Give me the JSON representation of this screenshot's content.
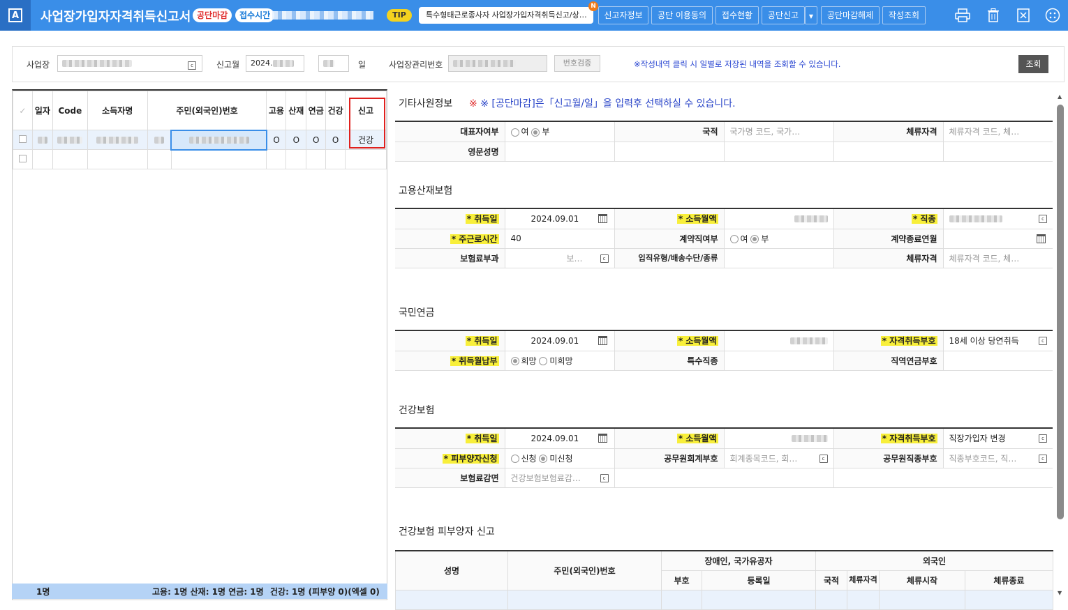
{
  "header": {
    "logo": "A",
    "title": "사업장가입자자격취득신고서",
    "badge_closed": "공단마감",
    "badge_recv": "접수시간",
    "tip": "TIP",
    "tip_text": "특수형태근로종사자 사업장가입자격취득신고/상…",
    "tip_badge": "N",
    "buttons": [
      "신고자정보",
      "공단 이용동의",
      "접수현황",
      "공단신고",
      "공단마감해제",
      "작성조회"
    ]
  },
  "search": {
    "biz_label": "사업장",
    "month_label": "신고월",
    "month_value": "2024.",
    "day_label": "일",
    "mgmt_label": "사업장관리번호",
    "verify": "번호검증",
    "notice": "※작성내역 클릭 시 일별로 저장된 내역을 조회할 수 있습니다.",
    "query": "조회"
  },
  "left": {
    "headers": [
      "일자",
      "Code",
      "소득자명",
      "주민(외국인)번호",
      "고용",
      "산재",
      "연금",
      "건강",
      "신고"
    ],
    "row": {
      "emp": "O",
      "ind": "O",
      "pen": "O",
      "hlth": "O",
      "report": "건강"
    },
    "footer": {
      "count": "1명",
      "summary": "고용: 1명 산재: 1명 연금: 1명",
      "health": "건강: 1명 (피부양 0)(엑셀 0)"
    }
  },
  "right": {
    "etc": {
      "title": "기타사원정보",
      "notice": "※ [공단마감]은「신고월/일」을 입력후 선택하실 수 있습니다.",
      "rep": "대표자여부",
      "yes": "여",
      "no": "부",
      "nation": "국적",
      "nation_ph": "국가명 코드, 국가…",
      "stay": "체류자격",
      "stay_ph": "체류자격 코드, 체…",
      "eng": "영문성명"
    },
    "emp": {
      "title": "고용산재보험",
      "acq": "* 취득일",
      "acq_val": "2024.09.01",
      "income": "* 소득월액",
      "job": "* 직종",
      "hours": "* 주근로시간",
      "hours_val": "40",
      "contract": "계약직여부",
      "yes": "여",
      "no": "부",
      "end": "계약종료연월",
      "premium": "보험료부과",
      "premium_ph": "보…",
      "entry": "입직유형/배송수단/종류",
      "stay": "체류자격",
      "stay_ph": "체류자격 코드, 체…"
    },
    "pen": {
      "title": "국민연금",
      "acq": "* 취득일",
      "acq_val": "2024.09.01",
      "income": "* 소득월액",
      "code": "* 자격취득부호",
      "code_val": "18세 이상 당연취득",
      "pay": "* 취득월납부",
      "want": "희망",
      "nowant": "미희망",
      "special": "특수직종",
      "occ": "직역연금부호"
    },
    "hlth": {
      "title": "건강보험",
      "acq": "* 취득일",
      "acq_val": "2024.09.01",
      "income": "* 소득월액",
      "code": "* 자격취득부호",
      "code_val": "직장가입자 변경",
      "dep": "* 피부양자신청",
      "apply": "신청",
      "noapply": "미신청",
      "acct": "공무원회계부호",
      "acct_ph": "회계종목코드, 회…",
      "occ": "공무원직종부호",
      "occ_ph": "직종부호코드, 직…",
      "reduce": "보험료감면",
      "reduce_ph": "건강보험보험료감…"
    },
    "dep": {
      "title": "건강보험 피부양자 신고",
      "name": "성명",
      "rrn": "주민(외국인)번호",
      "disabled": "장애인, 국가유공자",
      "foreign": "외국인",
      "code": "부호",
      "reg": "등록일",
      "nation": "국적",
      "stay": "체류자격",
      "start": "체류시작",
      "end": "체류종료"
    }
  }
}
